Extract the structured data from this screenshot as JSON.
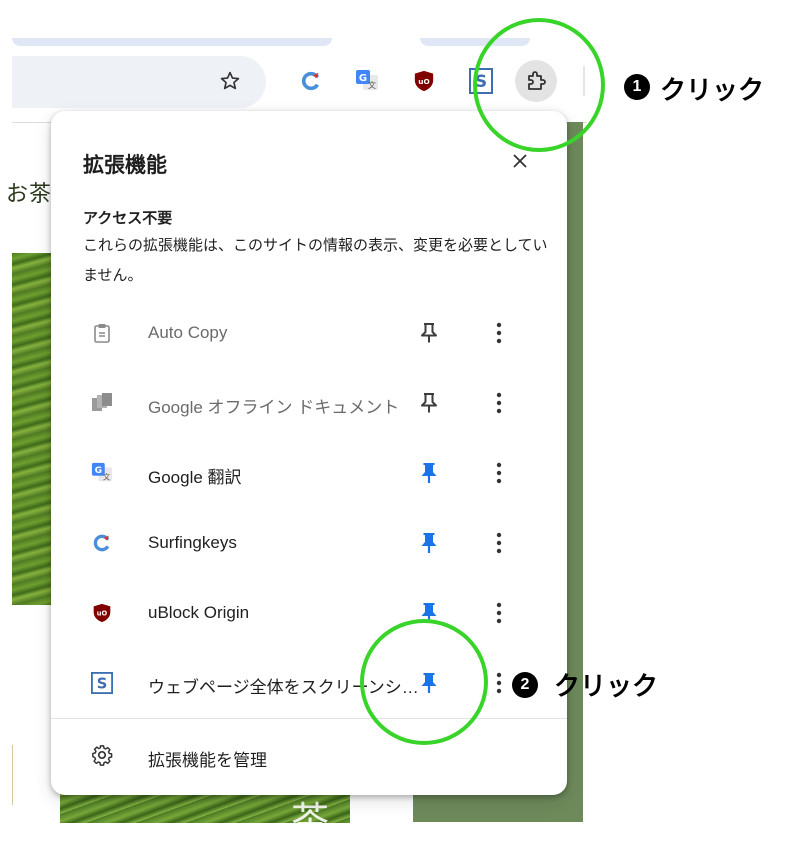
{
  "toolbar": {
    "bookmark_icon": "star-icon",
    "extensions_button_icon": "puzzle-icon"
  },
  "background_page": {
    "heading_fragment": "お茶",
    "bottom_kanji": "茶"
  },
  "popup": {
    "title": "拡張機能",
    "close_icon": "close-icon",
    "section_heading": "アクセス不要",
    "section_description": "これらの拡張機能は、このサイトの情報の表示、変更を必要としていません。",
    "extensions": [
      {
        "name": "Auto Copy",
        "icon": "clipboard-icon",
        "pinned": false,
        "dimmed": true
      },
      {
        "name": "Google オフライン ドキュメント",
        "icon": "docs-offline-icon",
        "pinned": false,
        "dimmed": true
      },
      {
        "name": "Google 翻訳",
        "icon": "google-translate-icon",
        "pinned": true,
        "dimmed": false
      },
      {
        "name": "Surfingkeys",
        "icon": "surfingkeys-icon",
        "pinned": true,
        "dimmed": false
      },
      {
        "name": "uBlock Origin",
        "icon": "ublock-icon",
        "pinned": true,
        "dimmed": false
      },
      {
        "name": "ウェブページ全体をスクリーンシ…",
        "icon": "fullpage-screenshot-icon",
        "pinned": true,
        "dimmed": false
      }
    ],
    "manage_label": "拡張機能を管理"
  },
  "annotations": {
    "step1": {
      "number": "1",
      "label": "クリック"
    },
    "step2": {
      "number": "2",
      "label": "クリック"
    }
  },
  "colors": {
    "pin_active": "#1a73e8",
    "pin_inactive": "#3c3c3c",
    "annotation_ring": "#39d42a",
    "background_green": "#6e8a5b"
  }
}
